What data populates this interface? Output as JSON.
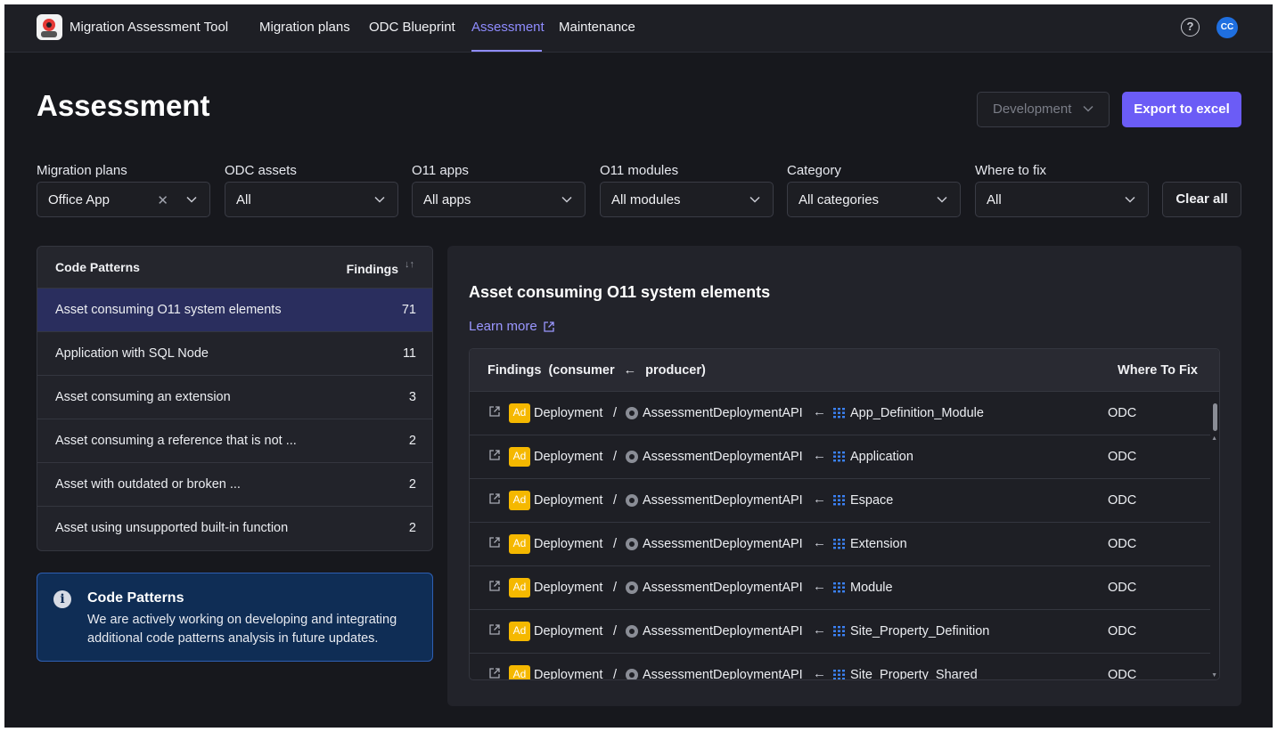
{
  "app": {
    "title": "Migration Assessment Tool"
  },
  "nav": [
    {
      "label": "Migration plans"
    },
    {
      "label": "ODC Blueprint"
    },
    {
      "label": "Assessment"
    },
    {
      "label": "Maintenance"
    }
  ],
  "user": {
    "initials": "CC"
  },
  "page": {
    "title": "Assessment"
  },
  "environment": {
    "selected": "Development"
  },
  "export": {
    "label": "Export to excel"
  },
  "filters": [
    {
      "label": "Migration plans",
      "value": "Office App"
    },
    {
      "label": "ODC assets",
      "value": "All"
    },
    {
      "label": "O11 apps",
      "value": "All apps"
    },
    {
      "label": "O11 modules",
      "value": "All modules"
    },
    {
      "label": "Category",
      "value": "All categories"
    },
    {
      "label": "Where to fix",
      "value": "All"
    }
  ],
  "clear_all": "Clear all",
  "patterns": {
    "header": "Code Patterns",
    "count_header": "Findings",
    "items": [
      {
        "label": "Asset consuming O11 system elements",
        "count": "71"
      },
      {
        "label": "Application with SQL Node",
        "count": "11"
      },
      {
        "label": "Asset consuming an extension",
        "count": "3"
      },
      {
        "label": "Asset consuming a reference that is not ...",
        "count": "2"
      },
      {
        "label": "Asset with outdated or broken ...",
        "count": "2"
      },
      {
        "label": "Asset using unsupported built-in function",
        "count": "2"
      }
    ]
  },
  "info": {
    "title": "Code Patterns",
    "text": "We are actively working on developing and integrating additional code patterns analysis in future updates."
  },
  "detail": {
    "title": "Asset consuming O11 system elements",
    "learn_more": "Learn more",
    "col_findings": "Findings  (consumer",
    "col_arrow": "←",
    "col_producer": "producer)",
    "col_where": "Where To Fix",
    "rows": [
      {
        "badge": "Ad",
        "app": "Deployment",
        "sep": "/",
        "module": "AssessmentDeploymentAPI",
        "arrow": "←",
        "element": "App_Definition_Module",
        "where": "ODC"
      },
      {
        "badge": "Ad",
        "app": "Deployment",
        "sep": "/",
        "module": "AssessmentDeploymentAPI",
        "arrow": "←",
        "element": "Application",
        "where": "ODC"
      },
      {
        "badge": "Ad",
        "app": "Deployment",
        "sep": "/",
        "module": "AssessmentDeploymentAPI",
        "arrow": "←",
        "element": "Espace",
        "where": "ODC"
      },
      {
        "badge": "Ad",
        "app": "Deployment",
        "sep": "/",
        "module": "AssessmentDeploymentAPI",
        "arrow": "←",
        "element": "Extension",
        "where": "ODC"
      },
      {
        "badge": "Ad",
        "app": "Deployment",
        "sep": "/",
        "module": "AssessmentDeploymentAPI",
        "arrow": "←",
        "element": "Module",
        "where": "ODC"
      },
      {
        "badge": "Ad",
        "app": "Deployment",
        "sep": "/",
        "module": "AssessmentDeploymentAPI",
        "arrow": "←",
        "element": "Site_Property_Definition",
        "where": "ODC"
      },
      {
        "badge": "Ad",
        "app": "Deployment",
        "sep": "/",
        "module": "AssessmentDeploymentAPI",
        "arrow": "←",
        "element": "Site_Property_Shared",
        "where": "ODC"
      }
    ]
  },
  "colors": {
    "accent": "#6b5cf6",
    "link": "#9a97ff",
    "badge": "#f5b800",
    "selected_row": "#2a2e5e",
    "info_bg": "#0f2d55"
  }
}
